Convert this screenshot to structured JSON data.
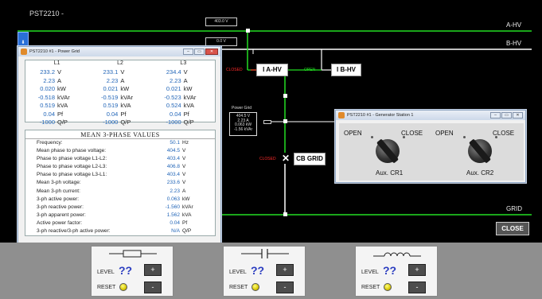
{
  "app": {
    "title": "PST2210 -"
  },
  "buses": {
    "ahv": "A-HV",
    "bhv": "B-HV",
    "grid": "GRID"
  },
  "volt_readouts": {
    "a": "403.0 V",
    "b": "0.0 V"
  },
  "breakers": {
    "iahv": {
      "state": "CLOSED",
      "label": "I A-HV"
    },
    "ibhv": {
      "state": "OPEN",
      "label": "I B-HV"
    },
    "cbgrid": {
      "state": "CLOSED",
      "label": "CB GRID"
    }
  },
  "power_grid_box": {
    "title": "Power Grid",
    "lines": [
      "404.5 V",
      "2.23 A",
      "0.063 kW",
      "-1.56 kVAr"
    ]
  },
  "power_window": {
    "title": "PST2210 #1 - Power Grid",
    "headers": [
      "L1",
      "L2",
      "L3"
    ],
    "rows": [
      {
        "unit": "V",
        "v": [
          "233.2",
          "233.1",
          "234.4"
        ]
      },
      {
        "unit": "A",
        "v": [
          "2.23",
          "2.23",
          "2.23"
        ]
      },
      {
        "unit": "kW",
        "v": [
          "0.020",
          "0.021",
          "0.021"
        ]
      },
      {
        "unit": "kVAr",
        "v": [
          "-0.518",
          "-0.519",
          "-0.523"
        ]
      },
      {
        "unit": "kVA",
        "v": [
          "0.519",
          "0.519",
          "0.524"
        ]
      },
      {
        "unit": "Pf",
        "v": [
          "0.04",
          "0.04",
          "0.04"
        ]
      },
      {
        "unit": "Q/P",
        "v": [
          "-1000",
          "-1000",
          "-1000"
        ]
      }
    ],
    "mean_title": "MEAN 3-PHASE VALUES",
    "mean_rows": [
      {
        "label": "Frequency:",
        "value": "50.1",
        "unit": "Hz"
      },
      {
        "label": "Mean phase to phase voltage:",
        "value": "404.5",
        "unit": "V"
      },
      {
        "label": "Phase to phase voltage L1-L2:",
        "value": "403.4",
        "unit": "V"
      },
      {
        "label": "Phase to phase voltage L2-L3:",
        "value": "406.8",
        "unit": "V"
      },
      {
        "label": "Phase to phase voltage L3-L1:",
        "value": "403.4",
        "unit": "V"
      },
      {
        "label": "Mean 3-ph voltage:",
        "value": "233.6",
        "unit": "V"
      },
      {
        "label": "Mean 3-ph current:",
        "value": "2.23",
        "unit": "A"
      },
      {
        "label": "3-ph active power:",
        "value": "0.063",
        "unit": "kW"
      },
      {
        "label": "3-ph reactive power:",
        "value": "-1.560",
        "unit": "kVAr"
      },
      {
        "label": "3-ph apparent power:",
        "value": "1.562",
        "unit": "kVA"
      },
      {
        "label": "Active power factor:",
        "value": "0.04",
        "unit": "Pf"
      },
      {
        "label": "3-ph reactive/3-ph active power:",
        "value": "N/A",
        "unit": "Q/P"
      }
    ]
  },
  "gen_window": {
    "title": "PST2210 #1 - Generator Station 1",
    "open": "OPEN",
    "close": "CLOSE",
    "aux1": "Aux. CR1",
    "aux2": "Aux. CR2"
  },
  "close_button": "CLOSE",
  "controls": {
    "level_label": "LEVEL",
    "level_value": "??",
    "reset_label": "RESET",
    "plus": "+",
    "minus": "-"
  },
  "colors": {
    "green_line": "#22dd22",
    "white_line": "#ffffff",
    "knob_yellow": "#e6d400"
  }
}
